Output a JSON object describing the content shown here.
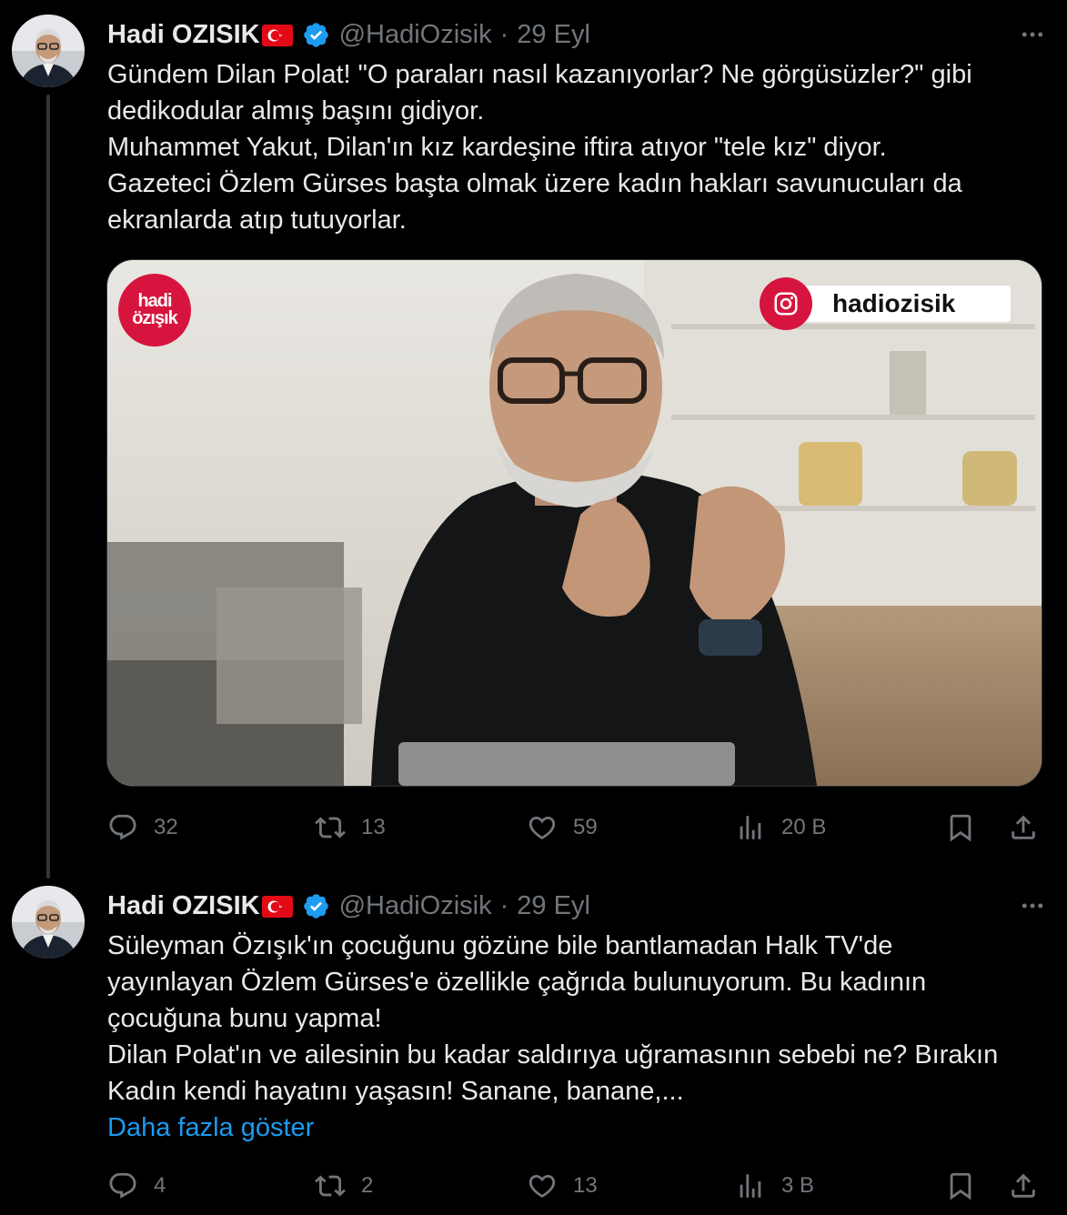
{
  "tweets": [
    {
      "display_name": "Hadi OZISIK",
      "handle": "@HadiOzisik",
      "separator": "·",
      "time": "29 Eyl",
      "lines": [
        "Gündem Dilan Polat! \"O paraları nasıl kazanıyorlar? Ne görgüsüzler?\" gibi",
        "dedikodular almış başını gidiyor.",
        "Muhammet Yakut, Dilan'ın kız kardeşine iftira atıyor \"tele kız\" diyor.",
        "Gazeteci Özlem Gürses başta olmak üzere kadın hakları savunucuları da",
        "ekranlarda atıp tutuyorlar."
      ],
      "media": {
        "brand_badge_line1": "hadi",
        "brand_badge_line2": "özışık",
        "instagram_handle": "hadiozisik"
      },
      "stats": {
        "replies": "32",
        "reposts": "13",
        "likes": "59",
        "views": "20 B"
      }
    },
    {
      "display_name": "Hadi OZISIK",
      "handle": "@HadiOzisik",
      "separator": "·",
      "time": "29 Eyl",
      "lines": [
        "Süleyman Özışık'ın çocuğunu gözüne bile bantlamadan Halk TV'de",
        "yayınlayan Özlem Gürses'e özellikle çağrıda bulunuyorum. Bu kadının",
        "çocuğuna bunu yapma!",
        "Dilan Polat'ın ve ailesinin bu kadar saldırıya uğramasının sebebi ne? Bırakın",
        "Kadın kendi hayatını yaşasın! Sanane, banane,..."
      ],
      "show_more": "Daha fazla göster",
      "stats": {
        "replies": "4",
        "reposts": "2",
        "likes": "13",
        "views": "3 B"
      }
    }
  ],
  "colors": {
    "background": "#000000",
    "text": "#e7e9ea",
    "muted": "#71767b",
    "link": "#1d9bf0",
    "verified": "#1d9bf0",
    "thread_line": "#333639",
    "brand_red": "#d7143d"
  },
  "icons": [
    "more-icon",
    "verified-icon",
    "turkey-flag-icon",
    "reply-icon",
    "repost-icon",
    "like-icon",
    "views-icon",
    "bookmark-icon",
    "share-icon",
    "instagram-icon"
  ]
}
